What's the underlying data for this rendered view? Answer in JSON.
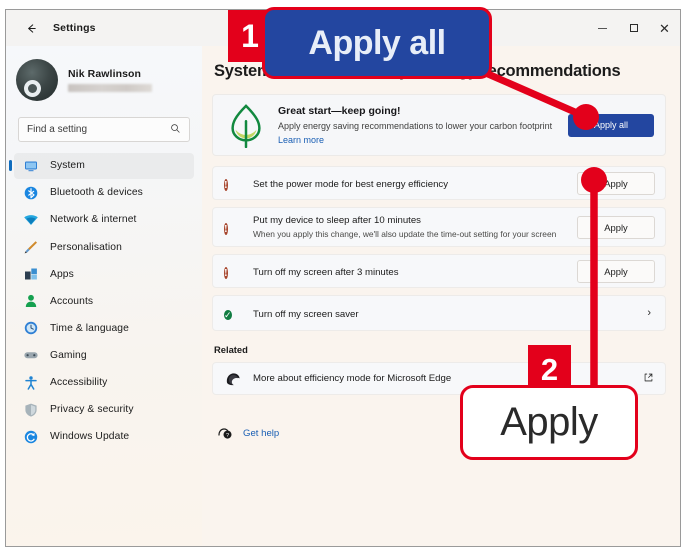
{
  "window": {
    "app_title": "Settings",
    "back_icon": "back-arrow-icon",
    "controls": {
      "minimize": "minimize-icon",
      "maximize": "maximize-icon",
      "close": "close-icon"
    }
  },
  "sidebar": {
    "profile": {
      "name": "Nik Rawlinson",
      "email_redacted": "",
      "avatar": "user-avatar"
    },
    "search": {
      "placeholder": "Find a setting",
      "icon": "search-icon",
      "value": ""
    },
    "items": [
      {
        "label": "System",
        "icon": "monitor-icon",
        "active": true
      },
      {
        "label": "Bluetooth & devices",
        "icon": "bluetooth-icon",
        "active": false
      },
      {
        "label": "Network & internet",
        "icon": "wifi-icon",
        "active": false
      },
      {
        "label": "Personalisation",
        "icon": "paintbrush-icon",
        "active": false
      },
      {
        "label": "Apps",
        "icon": "apps-icon",
        "active": false
      },
      {
        "label": "Accounts",
        "icon": "person-icon",
        "active": false
      },
      {
        "label": "Time & language",
        "icon": "clock-icon",
        "active": false
      },
      {
        "label": "Gaming",
        "icon": "gamepad-icon",
        "active": false
      },
      {
        "label": "Accessibility",
        "icon": "accessibility-icon",
        "active": false
      },
      {
        "label": "Privacy & security",
        "icon": "shield-icon",
        "active": false
      },
      {
        "label": "Windows Update",
        "icon": "update-icon",
        "active": false
      }
    ]
  },
  "main": {
    "page_title": "System › Power & battery › Energy recommendations",
    "page_title_visible_start": "Sy",
    "page_title_visible_end": "nendations",
    "banner": {
      "icon": "leaf-icon",
      "heading": "Great start—keep going!",
      "body": "Apply energy saving recommendations to lower your carbon footprint",
      "link": "Learn more",
      "button": "Apply all"
    },
    "recommendations": [
      {
        "status_icon": "warning-exclamation-icon",
        "status": "pending",
        "title": "Set the power mode for best energy efficiency",
        "subtitle": "",
        "action": "Apply",
        "action_type": "button"
      },
      {
        "status_icon": "warning-exclamation-icon",
        "status": "pending",
        "title": "Put my device to sleep after 10 minutes",
        "subtitle": "When you apply this change, we'll also update the time-out setting for your screen",
        "action": "Apply",
        "action_type": "button"
      },
      {
        "status_icon": "warning-exclamation-icon",
        "status": "pending",
        "title": "Turn off my screen after 3 minutes",
        "subtitle": "",
        "action": "Apply",
        "action_type": "button"
      },
      {
        "status_icon": "check-circle-icon",
        "status": "done",
        "title": "Turn off my screen saver",
        "subtitle": "",
        "action": "›",
        "action_type": "chevron"
      }
    ],
    "related": {
      "label": "Related",
      "item_icon": "edge-browser-icon",
      "item_label": "More about efficiency mode for Microsoft Edge",
      "external_icon": "external-link-icon"
    },
    "get_help": {
      "icon": "help-icon",
      "label": "Get help"
    }
  },
  "annotations": {
    "accent_color": "#e3001b",
    "callouts": [
      {
        "number": "1",
        "zoom_label": "Apply all",
        "style": "blue-button"
      },
      {
        "number": "2",
        "zoom_label": "Apply",
        "style": "white-button"
      }
    ]
  }
}
